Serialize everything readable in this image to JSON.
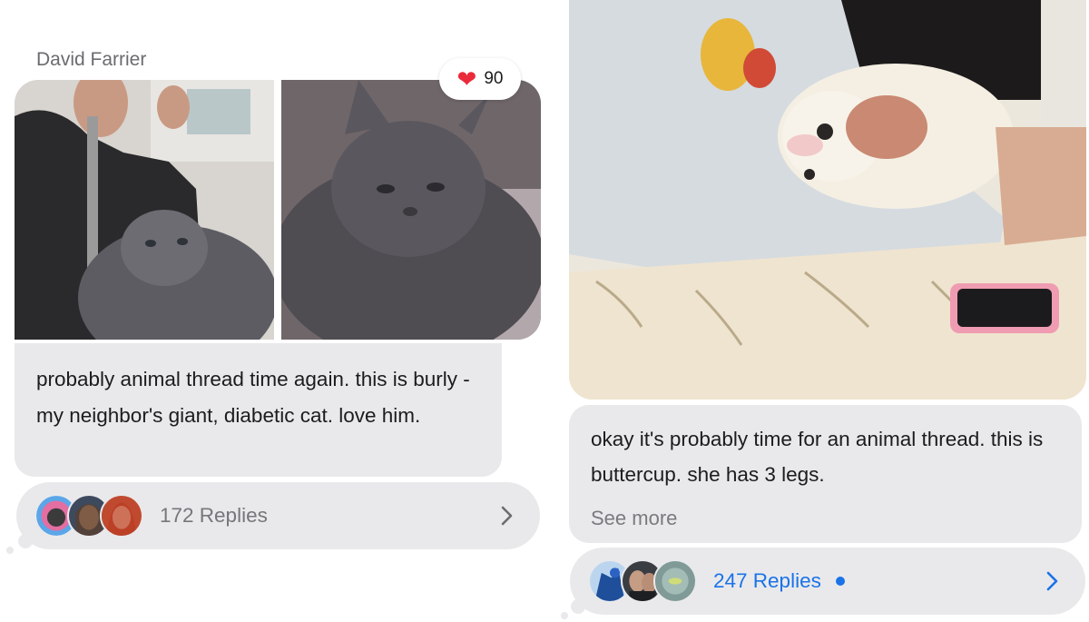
{
  "left_message": {
    "sender": "David Farrier",
    "reaction": {
      "icon": "heart-icon",
      "count": "90"
    },
    "text": "probably animal thread time again. this is burly - my neighbor's giant, diabetic cat. love him.",
    "replies_label": "172 Replies"
  },
  "right_message": {
    "text": "okay it's probably time for an animal thread. this is buttercup. she has 3 legs.",
    "see_more": "See more",
    "replies_label": "247 Replies",
    "unread": true
  },
  "colors": {
    "bubble": "#e9e9eb",
    "link": "#1a73e8",
    "heart": "#ea2a3a",
    "secondary_text": "#76767b"
  }
}
